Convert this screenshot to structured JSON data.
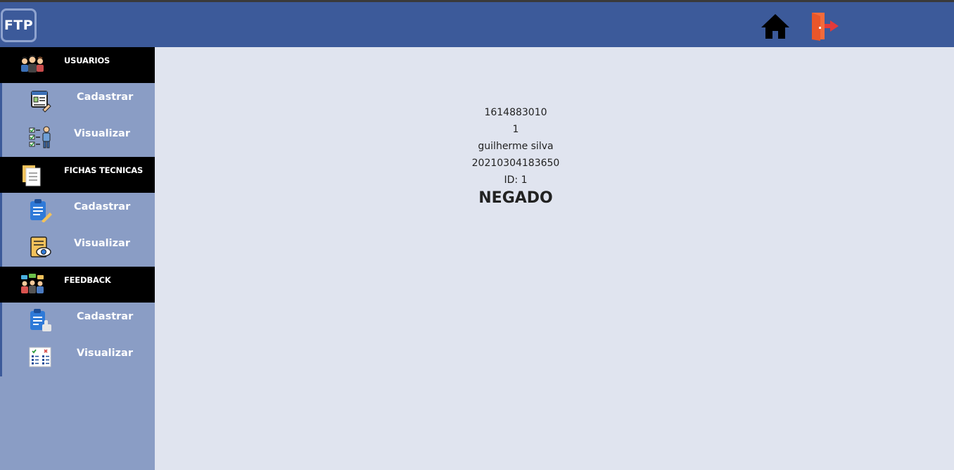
{
  "header": {
    "logo_text": "FTP",
    "home_icon": "home-icon",
    "exit_icon": "exit-door-icon"
  },
  "sidebar": {
    "sections": [
      {
        "title": "USUARIOS",
        "icon": "users-group-icon",
        "items": [
          {
            "label": "Cadastrar",
            "icon": "user-register-icon"
          },
          {
            "label": "Visualizar",
            "icon": "user-list-icon"
          }
        ]
      },
      {
        "title": "FICHAS TECNICAS",
        "icon": "documents-icon",
        "items": [
          {
            "label": "Cadastrar",
            "icon": "clipboard-edit-icon"
          },
          {
            "label": "Visualizar",
            "icon": "document-view-icon"
          }
        ]
      },
      {
        "title": "FEEDBACK",
        "icon": "feedback-people-icon",
        "items": [
          {
            "label": "Cadastrar",
            "icon": "clipboard-like-icon"
          },
          {
            "label": "Visualizar",
            "icon": "checklist-icon"
          }
        ]
      }
    ]
  },
  "main": {
    "line1": "1614883010",
    "line2": "1",
    "line3": "guilherme silva",
    "line4": "20210304183650",
    "line5": "ID: 1",
    "status": "NEGADO"
  },
  "colors": {
    "topbar": "#3c5a9a",
    "sidebar": "#8a9dc5",
    "section_header": "#000000",
    "content_bg": "#e0e4ef"
  }
}
